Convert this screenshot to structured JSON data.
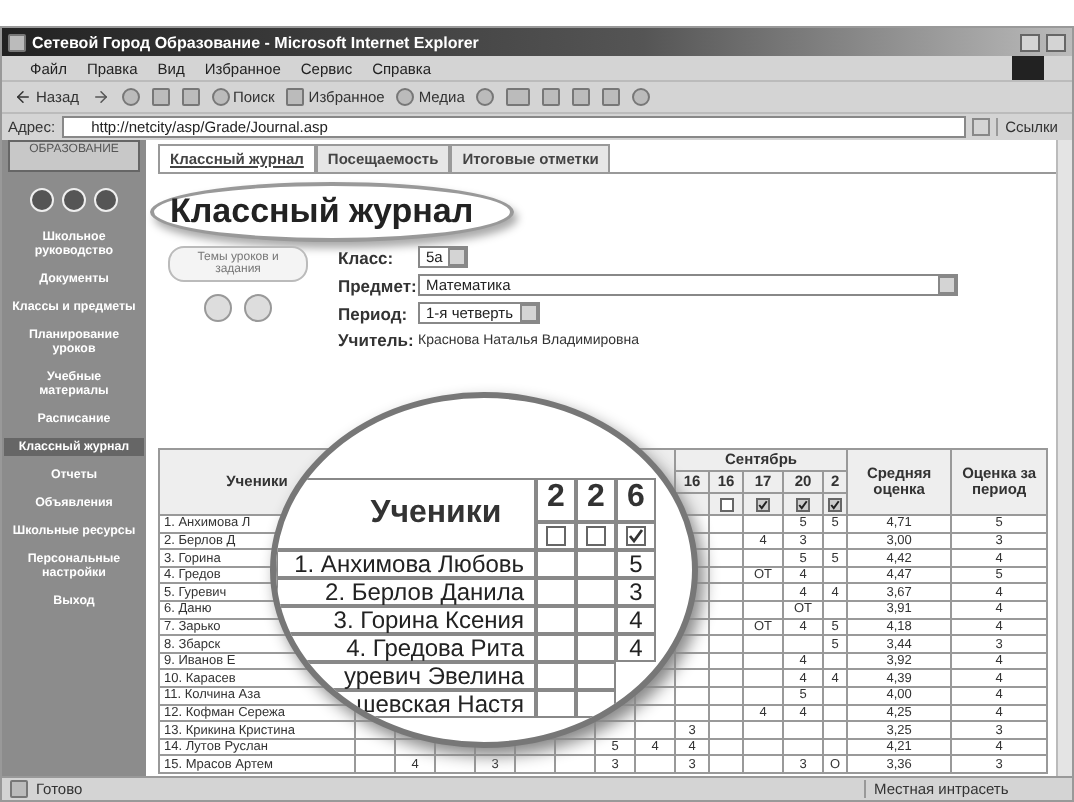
{
  "window": {
    "title": "Сетевой Город Образование - Microsoft Internet Explorer"
  },
  "menu": [
    "Файл",
    "Правка",
    "Вид",
    "Избранное",
    "Сервис",
    "Справка"
  ],
  "toolbar": {
    "back": "Назад",
    "search": "Поиск",
    "favorites": "Избранное",
    "media": "Медиа"
  },
  "address_bar": {
    "label": "Адрес:",
    "value": "http://netcity/asp/Grade/Journal.asp",
    "links": "Ссылки"
  },
  "sidebar": {
    "logo": "ОБРАЗОВАНИЕ",
    "items": [
      {
        "label": "Школьное руководство",
        "selected": false
      },
      {
        "label": "Документы",
        "selected": false
      },
      {
        "label": "Классы и предметы",
        "selected": false
      },
      {
        "label": "Планирование уроков",
        "selected": false
      },
      {
        "label": "Учебные материалы",
        "selected": false
      },
      {
        "label": "Расписание",
        "selected": false
      },
      {
        "label": "Классный журнал",
        "selected": true
      },
      {
        "label": "Отчеты",
        "selected": false
      },
      {
        "label": "Объявления",
        "selected": false
      },
      {
        "label": "Школьные ресурсы",
        "selected": false
      },
      {
        "label": "Персональные настройки",
        "selected": false
      },
      {
        "label": "Выход",
        "selected": false
      }
    ]
  },
  "tabs": [
    {
      "label": "Классный журнал",
      "selected": true
    },
    {
      "label": "Посещаемость",
      "selected": false
    },
    {
      "label": "Итоговые отметки",
      "selected": false
    }
  ],
  "page_title": "Классный журнал",
  "lessons_button": "Темы уроков и задания",
  "form": [
    {
      "label": "Класс:",
      "value": "5а",
      "kind": "select"
    },
    {
      "label": "Предмет:",
      "value": "Математика",
      "kind": "wide-select"
    },
    {
      "label": "Период:",
      "value": "1-я четверть",
      "kind": "select"
    },
    {
      "label": "Учитель:",
      "value": "Краснова Наталья Владимировна",
      "kind": "text"
    }
  ],
  "table": {
    "students_heading": "Ученики",
    "month": "Сентябрь",
    "average_heading": "Средняя оценка",
    "period_heading": "Оценка за период",
    "columns": [
      {
        "kind": "covered"
      },
      {
        "kind": "covered"
      },
      {
        "kind": "covered"
      },
      {
        "kind": "covered"
      },
      {
        "kind": "covered"
      },
      {
        "kind": "covered"
      },
      {
        "kind": "covered"
      },
      {
        "kind": "covered"
      },
      {
        "kind": "day",
        "label": "16"
      },
      {
        "kind": "day",
        "label": "16",
        "checked": false
      },
      {
        "kind": "day",
        "label": "17",
        "checked": true
      },
      {
        "kind": "day",
        "label": "20",
        "checked": true
      },
      {
        "kind": "day",
        "label": "2",
        "checked": true
      }
    ],
    "rows": [
      {
        "name": "1. Анхимова Л",
        "cells": [
          {
            "kind": "blank"
          },
          {
            "kind": "blank"
          },
          {
            "kind": "blank"
          },
          {
            "kind": "blank"
          },
          {
            "kind": "blank"
          },
          {
            "kind": "blank"
          },
          {
            "kind": "blank"
          },
          {
            "kind": "blank"
          },
          {
            "kind": "blank"
          },
          {
            "kind": "blank"
          },
          {
            "kind": "blank"
          },
          {
            "kind": "mark",
            "text": "5"
          },
          {
            "kind": "mark",
            "text": "5"
          }
        ],
        "average": "4,71",
        "period": "5"
      },
      {
        "name": "2. Берлов Д",
        "cells": [
          {
            "kind": "blank"
          },
          {
            "kind": "blank"
          },
          {
            "kind": "blank"
          },
          {
            "kind": "blank"
          },
          {
            "kind": "blank"
          },
          {
            "kind": "blank"
          },
          {
            "kind": "blank"
          },
          {
            "kind": "blank"
          },
          {
            "kind": "blank"
          },
          {
            "kind": "blank"
          },
          {
            "kind": "mark",
            "text": "4"
          },
          {
            "kind": "mark",
            "text": "3"
          },
          {
            "kind": "blank"
          }
        ],
        "average": "3,00",
        "period": "3"
      },
      {
        "name": "3. Горина",
        "cells": [
          {
            "kind": "blank"
          },
          {
            "kind": "blank"
          },
          {
            "kind": "blank"
          },
          {
            "kind": "blank"
          },
          {
            "kind": "blank"
          },
          {
            "kind": "blank"
          },
          {
            "kind": "blank"
          },
          {
            "kind": "blank"
          },
          {
            "kind": "blank"
          },
          {
            "kind": "blank"
          },
          {
            "kind": "blank"
          },
          {
            "kind": "mark",
            "text": "5"
          },
          {
            "kind": "mark",
            "text": "5"
          }
        ],
        "average": "4,42",
        "period": "4"
      },
      {
        "name": "4. Гредов",
        "cells": [
          {
            "kind": "blank"
          },
          {
            "kind": "blank"
          },
          {
            "kind": "blank"
          },
          {
            "kind": "blank"
          },
          {
            "kind": "blank"
          },
          {
            "kind": "blank"
          },
          {
            "kind": "blank"
          },
          {
            "kind": "blank"
          },
          {
            "kind": "blank"
          },
          {
            "kind": "blank"
          },
          {
            "kind": "mark",
            "text": "ОТ"
          },
          {
            "kind": "mark",
            "text": "4"
          },
          {
            "kind": "blank"
          }
        ],
        "average": "4,47",
        "period": "5"
      },
      {
        "name": "5. Гуревич",
        "cells": [
          {
            "kind": "blank"
          },
          {
            "kind": "blank"
          },
          {
            "kind": "blank"
          },
          {
            "kind": "blank"
          },
          {
            "kind": "blank"
          },
          {
            "kind": "blank"
          },
          {
            "kind": "blank"
          },
          {
            "kind": "blank"
          },
          {
            "kind": "blank"
          },
          {
            "kind": "blank"
          },
          {
            "kind": "blank"
          },
          {
            "kind": "mark",
            "text": "4"
          },
          {
            "kind": "mark",
            "text": "4"
          }
        ],
        "average": "3,67",
        "period": "4"
      },
      {
        "name": "6. Даню",
        "cells": [
          {
            "kind": "blank"
          },
          {
            "kind": "blank"
          },
          {
            "kind": "blank"
          },
          {
            "kind": "blank"
          },
          {
            "kind": "blank"
          },
          {
            "kind": "blank"
          },
          {
            "kind": "blank"
          },
          {
            "kind": "blank"
          },
          {
            "kind": "blank"
          },
          {
            "kind": "blank"
          },
          {
            "kind": "blank"
          },
          {
            "kind": "mark",
            "text": "ОТ"
          },
          {
            "kind": "blank"
          }
        ],
        "average": "3,91",
        "period": "4"
      },
      {
        "name": "7. Зарько",
        "cells": [
          {
            "kind": "blank"
          },
          {
            "kind": "blank"
          },
          {
            "kind": "blank"
          },
          {
            "kind": "blank"
          },
          {
            "kind": "blank"
          },
          {
            "kind": "blank"
          },
          {
            "kind": "blank"
          },
          {
            "kind": "blank"
          },
          {
            "kind": "blank"
          },
          {
            "kind": "blank"
          },
          {
            "kind": "mark",
            "text": "ОТ"
          },
          {
            "kind": "mark",
            "text": "4"
          },
          {
            "kind": "mark",
            "text": "5"
          }
        ],
        "average": "4,18",
        "period": "4"
      },
      {
        "name": "8. Збарск",
        "cells": [
          {
            "kind": "blank"
          },
          {
            "kind": "blank"
          },
          {
            "kind": "blank"
          },
          {
            "kind": "blank"
          },
          {
            "kind": "blank"
          },
          {
            "kind": "blank"
          },
          {
            "kind": "blank"
          },
          {
            "kind": "blank"
          },
          {
            "kind": "blank"
          },
          {
            "kind": "blank"
          },
          {
            "kind": "blank"
          },
          {
            "kind": "blank"
          },
          {
            "kind": "mark",
            "text": "5"
          }
        ],
        "average": "3,44",
        "period": "3"
      },
      {
        "name": "9. Иванов Е",
        "cells": [
          {
            "kind": "blank"
          },
          {
            "kind": "blank"
          },
          {
            "kind": "blank"
          },
          {
            "kind": "blank"
          },
          {
            "kind": "blank"
          },
          {
            "kind": "blank"
          },
          {
            "kind": "blank"
          },
          {
            "kind": "blank"
          },
          {
            "kind": "blank"
          },
          {
            "kind": "blank"
          },
          {
            "kind": "blank"
          },
          {
            "kind": "mark",
            "text": "4"
          },
          {
            "kind": "blank"
          }
        ],
        "average": "3,92",
        "period": "4"
      },
      {
        "name": "10. Карасев",
        "cells": [
          {
            "kind": "blank"
          },
          {
            "kind": "blank"
          },
          {
            "kind": "blank"
          },
          {
            "kind": "blank"
          },
          {
            "kind": "blank"
          },
          {
            "kind": "blank"
          },
          {
            "kind": "blank"
          },
          {
            "kind": "blank"
          },
          {
            "kind": "blank"
          },
          {
            "kind": "blank"
          },
          {
            "kind": "blank"
          },
          {
            "kind": "mark",
            "text": "4"
          },
          {
            "kind": "mark",
            "text": "4"
          }
        ],
        "average": "4,39",
        "period": "4"
      },
      {
        "name": "11. Колчина Аза",
        "cells": [
          {
            "kind": "blank"
          },
          {
            "kind": "blank"
          },
          {
            "kind": "blank"
          },
          {
            "kind": "blank"
          },
          {
            "kind": "blank"
          },
          {
            "kind": "blank"
          },
          {
            "kind": "blank"
          },
          {
            "kind": "blank"
          },
          {
            "kind": "blank"
          },
          {
            "kind": "blank"
          },
          {
            "kind": "blank"
          },
          {
            "kind": "mark",
            "text": "5"
          },
          {
            "kind": "blank"
          }
        ],
        "average": "4,00",
        "period": "4"
      },
      {
        "name": "12. Кофман Сережа",
        "cells": [
          {
            "kind": "blank"
          },
          {
            "kind": "blank"
          },
          {
            "kind": "blank"
          },
          {
            "kind": "blank"
          },
          {
            "kind": "blank"
          },
          {
            "kind": "blank"
          },
          {
            "kind": "blank"
          },
          {
            "kind": "blank"
          },
          {
            "kind": "blank"
          },
          {
            "kind": "blank"
          },
          {
            "kind": "mark",
            "text": "4"
          },
          {
            "kind": "mark",
            "text": "4"
          },
          {
            "kind": "blank"
          }
        ],
        "average": "4,25",
        "period": "4"
      },
      {
        "name": "13. Крикина Кристина",
        "cells": [
          {
            "kind": "blank"
          },
          {
            "kind": "blank"
          },
          {
            "kind": "blank"
          },
          {
            "kind": "blank"
          },
          {
            "kind": "blank"
          },
          {
            "kind": "blank"
          },
          {
            "kind": "blank"
          },
          {
            "kind": "blank"
          },
          {
            "kind": "mark",
            "text": "3"
          },
          {
            "kind": "blank"
          },
          {
            "kind": "blank"
          },
          {
            "kind": "blank"
          },
          {
            "kind": "blank"
          }
        ],
        "average": "3,25",
        "period": "3"
      },
      {
        "name": "14. Лутов Руслан",
        "cells": [
          {
            "kind": "blank"
          },
          {
            "kind": "blank"
          },
          {
            "kind": "blank"
          },
          {
            "kind": "blank"
          },
          {
            "kind": "blank"
          },
          {
            "kind": "blank"
          },
          {
            "kind": "mark",
            "text": "5"
          },
          {
            "kind": "mark",
            "text": "4"
          },
          {
            "kind": "mark",
            "text": "4"
          },
          {
            "kind": "blank"
          },
          {
            "kind": "blank"
          },
          {
            "kind": "blank"
          },
          {
            "kind": "blank"
          }
        ],
        "average": "4,21",
        "period": "4"
      },
      {
        "name": "15. Мрасов Артем",
        "cells": [
          {
            "kind": "blank"
          },
          {
            "kind": "mark",
            "text": "4"
          },
          {
            "kind": "blank"
          },
          {
            "kind": "mark",
            "text": "3"
          },
          {
            "kind": "blank"
          },
          {
            "kind": "blank"
          },
          {
            "kind": "mark",
            "text": "3"
          },
          {
            "kind": "blank"
          },
          {
            "kind": "mark",
            "text": "3"
          },
          {
            "kind": "blank"
          },
          {
            "kind": "blank"
          },
          {
            "kind": "mark",
            "text": "3"
          },
          {
            "kind": "mark",
            "text": "О"
          }
        ],
        "average": "3,36",
        "period": "3"
      }
    ]
  },
  "magnifier": {
    "heading": "Ученики",
    "dates": [
      {
        "label": "2",
        "checked": false
      },
      {
        "label": "2",
        "checked": false
      },
      {
        "label": "6",
        "checked": true
      }
    ],
    "rows": [
      {
        "name": "1. Анхимова Любовь",
        "mark": "5"
      },
      {
        "name": "2. Берлов Данила",
        "mark": "3"
      },
      {
        "name": "3. Горина Ксения",
        "mark": "4"
      },
      {
        "name": "4. Гредова Рита",
        "mark": "4"
      },
      {
        "name": "уревич Эвелина"
      },
      {
        "name": "шевская Настя"
      }
    ]
  },
  "status_bar": {
    "text": "Готово",
    "zone": "Местная интрасеть"
  }
}
